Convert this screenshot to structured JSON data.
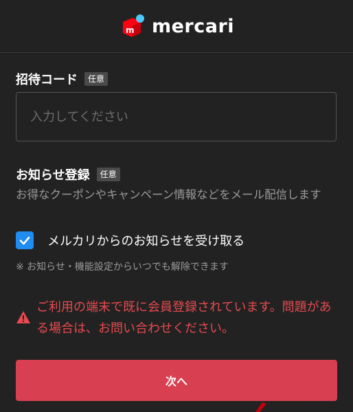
{
  "brand": {
    "logo_text": "mercari",
    "logo_icon": "mercari-box-logo",
    "colors": {
      "brand_red": "#ff0211",
      "brand_blue": "#4dc9ff"
    }
  },
  "invite_code": {
    "label": "招待コード",
    "badge": "任意",
    "placeholder": "入力してください",
    "value": ""
  },
  "notifications": {
    "label": "お知らせ登録",
    "badge": "任意",
    "description": "お得なクーポンやキャンペーン情報などをメール配信します",
    "checkbox_label": "メルカリからのお知らせを受け取る",
    "checked": true,
    "checkbox_color": "#1e8cf0",
    "note": "※ お知らせ・機能設定からいつでも解除できます"
  },
  "error": {
    "icon": "warning-icon",
    "message": "ご利用の端末で既に会員登録されています。問題がある場合は、お問い合わせください。",
    "color": "#e64a4f"
  },
  "actions": {
    "next_label": "次へ",
    "next_color": "#d83f50"
  }
}
